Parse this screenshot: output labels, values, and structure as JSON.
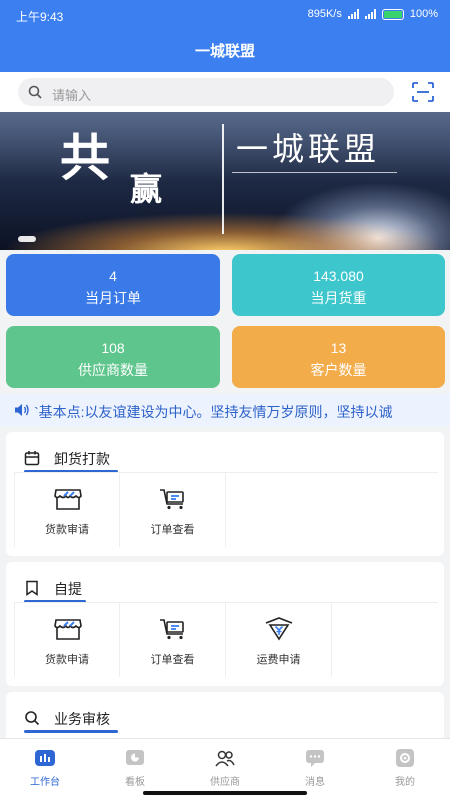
{
  "status": {
    "time": "上午9:43",
    "speed": "895K/s",
    "battery": "100%"
  },
  "header": {
    "title": "一城联盟"
  },
  "search": {
    "placeholder": "请输入"
  },
  "banner": {
    "char1": "共",
    "char2": "赢",
    "brand": "一城联盟"
  },
  "stats": [
    {
      "value": "4",
      "label": "当月订单",
      "color": "#3a79e8"
    },
    {
      "value": "143.080",
      "label": "当月货重",
      "color": "#3dc6cc"
    },
    {
      "value": "108",
      "label": "供应商数量",
      "color": "#5ec58c"
    },
    {
      "value": "13",
      "label": "客户数量",
      "color": "#f3ac4a"
    }
  ],
  "notice": {
    "text": "`基本点:以友谊建设为中心。坚持友情万岁原则，坚持以诚"
  },
  "sections": [
    {
      "title": "卸货打款",
      "icon": "calendar-icon",
      "items": [
        {
          "label": "货款审请",
          "icon": "shop-icon"
        },
        {
          "label": "订单查看",
          "icon": "cart-icon"
        }
      ]
    },
    {
      "title": "自提",
      "icon": "bookmark-icon",
      "items": [
        {
          "label": "货款申请",
          "icon": "shop-icon"
        },
        {
          "label": "订单查看",
          "icon": "cart-icon"
        },
        {
          "label": "运费申请",
          "icon": "yuan-icon"
        }
      ]
    },
    {
      "title": "业务审核",
      "icon": "search-icon",
      "items": []
    }
  ],
  "tabs": [
    {
      "label": "工作台",
      "icon": "workbench-icon",
      "active": true
    },
    {
      "label": "看板",
      "icon": "chart-icon"
    },
    {
      "label": "供应商",
      "icon": "people-icon"
    },
    {
      "label": "消息",
      "icon": "message-icon"
    },
    {
      "label": "我的",
      "icon": "settings-icon"
    }
  ],
  "colors": {
    "primary": "#3b7ff0",
    "accent": "#2e66d4"
  }
}
